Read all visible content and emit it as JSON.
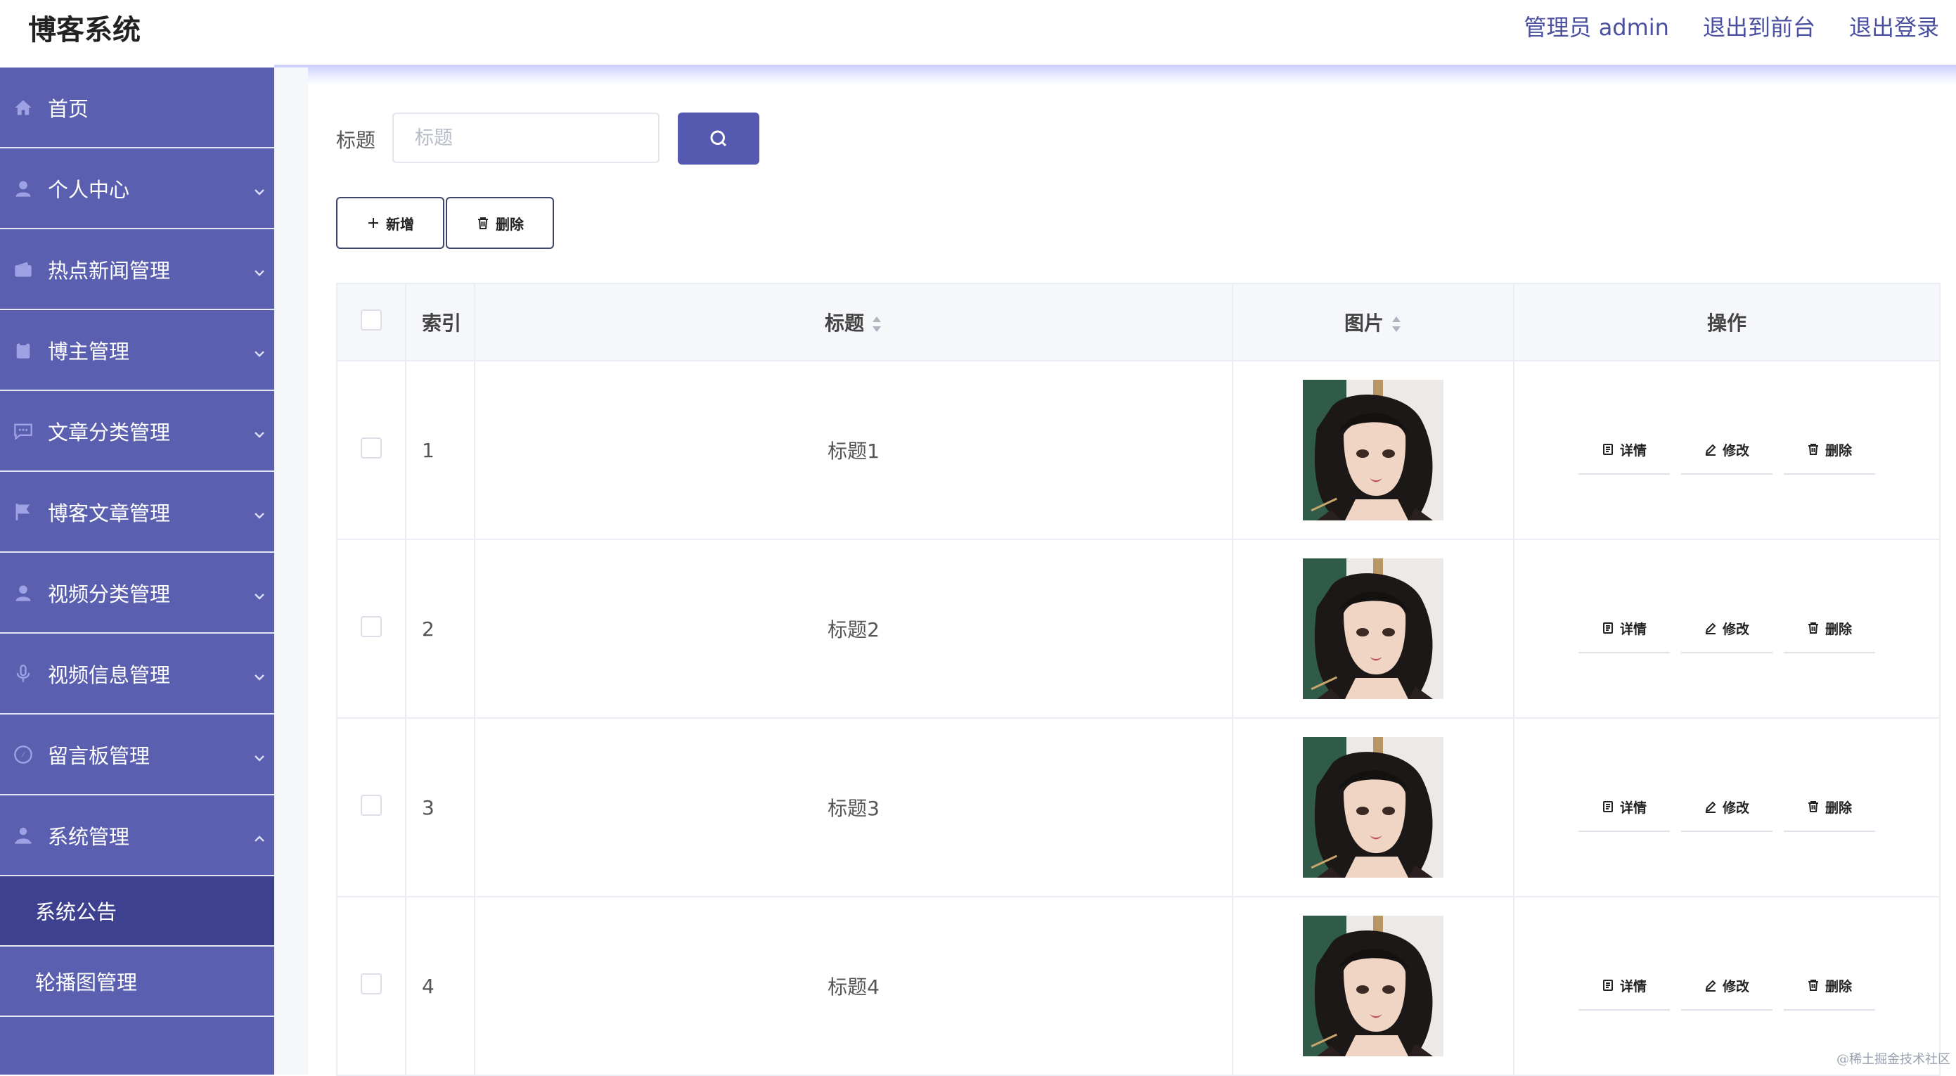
{
  "header": {
    "app_title": "博客系统",
    "admin_label": "管理员 admin",
    "front_link": "退出到前台",
    "logout_link": "退出登录"
  },
  "sidebar": {
    "items": [
      {
        "label": "首页",
        "icon": "home-icon"
      },
      {
        "label": "个人中心",
        "icon": "user-icon"
      },
      {
        "label": "热点新闻管理",
        "icon": "wallet-icon"
      },
      {
        "label": "博主管理",
        "icon": "clipboard-icon"
      },
      {
        "label": "文章分类管理",
        "icon": "chat-icon"
      },
      {
        "label": "博客文章管理",
        "icon": "flag-icon"
      },
      {
        "label": "视频分类管理",
        "icon": "user-icon"
      },
      {
        "label": "视频信息管理",
        "icon": "microphone-icon"
      },
      {
        "label": "留言板管理",
        "icon": "compass-icon"
      },
      {
        "label": "系统管理",
        "icon": "user-cog-icon"
      }
    ],
    "sub_items": [
      {
        "label": "系统公告"
      },
      {
        "label": "轮播图管理"
      }
    ]
  },
  "search": {
    "label": "标题",
    "placeholder": "标题",
    "value": ""
  },
  "toolbar": {
    "add_label": "新增",
    "delete_label": "删除"
  },
  "table": {
    "headers": {
      "index": "索引",
      "title": "标题",
      "image": "图片",
      "actions": "操作"
    },
    "rows": [
      {
        "index": "1",
        "title": "标题1"
      },
      {
        "index": "2",
        "title": "标题2"
      },
      {
        "index": "3",
        "title": "标题3"
      },
      {
        "index": "4",
        "title": "标题4"
      }
    ],
    "action_labels": {
      "detail": "详情",
      "edit": "修改",
      "delete": "删除"
    }
  },
  "watermark": "@稀土掘金技术社区",
  "colors": {
    "sidebar": "#5a5fb0",
    "sidebar_active": "#3d4190",
    "accent": "#555ab0",
    "header_link": "#4a4fa0"
  }
}
